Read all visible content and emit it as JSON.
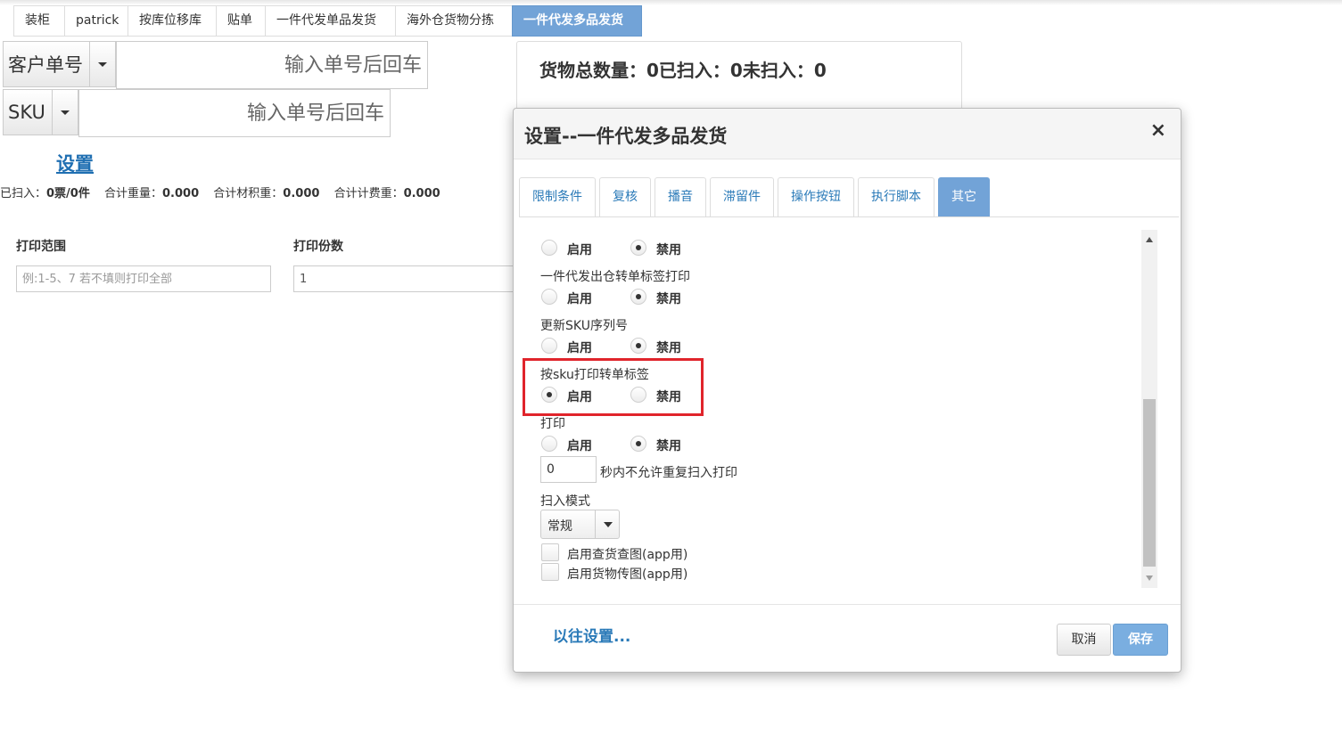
{
  "nav_tabs": [
    {
      "label": "装柜"
    },
    {
      "label": "patrick"
    },
    {
      "label": "按库位移库"
    },
    {
      "label": "贴单"
    },
    {
      "label": "一件代发单品发货"
    },
    {
      "label": "海外仓货物分拣"
    },
    {
      "label": "一件代发多品发货",
      "active": true
    }
  ],
  "scan": {
    "customer_order": {
      "label": "客户单号",
      "placeholder": "输入单号后回车"
    },
    "sku": {
      "label": "SKU",
      "placeholder": "输入单号后回车"
    }
  },
  "settings_link": "设置",
  "stats": {
    "scanned_label": "已扫入：",
    "scanned_value": "0票/0件",
    "weight_label": "合计重量：",
    "weight_value": "0.000",
    "volume_label": "合计材积重：",
    "volume_value": "0.000",
    "billing_label": "合计计费重：",
    "billing_value": "0.000"
  },
  "print": {
    "range_label": "打印范围",
    "range_placeholder": "例:1-5、7 若不填则打印全部",
    "copies_label": "打印份数",
    "copies_value": "1"
  },
  "summary": {
    "text": "货物总数量：0已扫入：0未扫入：0"
  },
  "modal": {
    "title": "设置--一件代发多品发货",
    "close": "×",
    "tabs": [
      {
        "label": "限制条件"
      },
      {
        "label": "复核"
      },
      {
        "label": "播音"
      },
      {
        "label": "滞留件"
      },
      {
        "label": "操作按钮"
      },
      {
        "label": "执行脚本"
      },
      {
        "label": "其它",
        "active": true
      }
    ],
    "enable_label": "启用",
    "disable_label": "禁用",
    "settings": [
      {
        "label": "",
        "value": "禁用"
      },
      {
        "label": "一件代发出仓转单标签打印",
        "value": "禁用"
      },
      {
        "label": "更新SKU序列号",
        "value": "禁用"
      },
      {
        "label": "按sku打印转单标签",
        "value": "启用"
      },
      {
        "label": "打印",
        "value": "禁用"
      }
    ],
    "repeat_seconds_value": "0",
    "repeat_seconds_text": "秒内不允许重复扫入打印",
    "scan_mode_label": "扫入模式",
    "scan_mode_value": "常规",
    "checkboxes": [
      {
        "label": "启用查货查图(app用)",
        "checked": false
      },
      {
        "label": "启用货物传图(app用)",
        "checked": false
      }
    ],
    "past_settings_link": "以往设置...",
    "cancel_button": "取消",
    "save_button": "保存"
  }
}
